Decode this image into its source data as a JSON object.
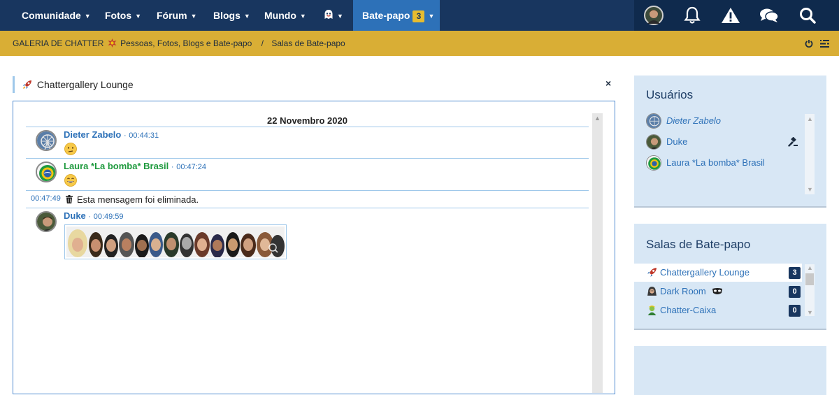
{
  "nav": {
    "items": [
      {
        "label": "Comunidade"
      },
      {
        "label": "Fotos"
      },
      {
        "label": "Fórum"
      },
      {
        "label": "Blogs"
      },
      {
        "label": "Mundo"
      }
    ],
    "chat": {
      "label": "Bate-papo",
      "badge": "3"
    },
    "icons": [
      "avatar",
      "bell-icon",
      "warning-icon",
      "chat-bubbles-icon",
      "search-icon"
    ]
  },
  "breadcrumb": {
    "site": "GALERIA DE CHATTER",
    "site_tagline": "Pessoas, Fotos, Blogs e Bate-papo",
    "separator": "/",
    "current": "Salas de Bate-papo"
  },
  "room": {
    "title": "Chattergallery Lounge",
    "close": "×"
  },
  "chat": {
    "date": "22 Novembro 2020",
    "messages": [
      {
        "user": "Dieter Zabelo",
        "sep": "·",
        "time": "00:44:31",
        "emoji": "confused"
      },
      {
        "user": "Laura *La bomba* Brasil",
        "sep": "·",
        "time": "00:47:24",
        "emoji": "grin"
      },
      {
        "time": "00:47:49",
        "text": "Esta mensagem foi eliminada."
      },
      {
        "user": "Duke",
        "sep": "·",
        "time": "00:49:59"
      }
    ]
  },
  "users_panel": {
    "title": "Usuários",
    "users": [
      {
        "name": "Dieter Zabelo"
      },
      {
        "name": "Duke"
      },
      {
        "name": "Laura *La bomba* Brasil"
      }
    ]
  },
  "rooms_panel": {
    "title": "Salas de Bate-papo",
    "rooms": [
      {
        "name": "Chattergallery Lounge",
        "count": "3"
      },
      {
        "name": "Dark Room",
        "count": "0"
      },
      {
        "name": "Chatter-Caixa",
        "count": "0"
      }
    ]
  },
  "colors": {
    "nav_bg": "#18365f",
    "nav_active": "#2d71b8",
    "gold": "#d9ae35",
    "panel_bg": "#d8e7f5",
    "link": "#2d71b8",
    "green_user": "#1f9a3e"
  }
}
